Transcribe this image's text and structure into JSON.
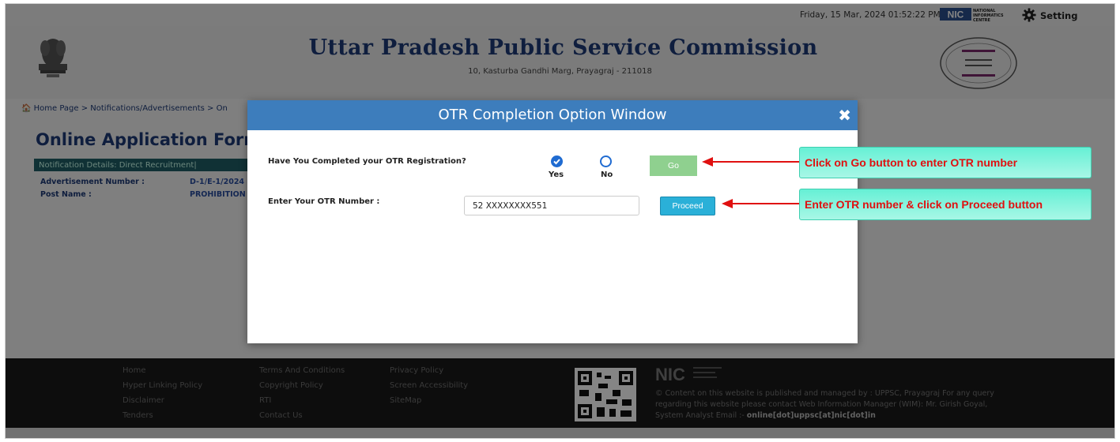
{
  "topbar": {
    "datetime": "Friday, 15 Mar, 2024 01:52:22 PM",
    "nic_small": "NATIONAL INFORMATICS CENTRE",
    "setting_label": "Setting"
  },
  "header": {
    "title": "Uttar Pradesh Public Service Commission",
    "address": "10, Kasturba Gandhi Marg, Prayagraj - 211018"
  },
  "breadcrumb": "🏠 Home Page > Notifications/Advertisements > On",
  "page": {
    "heading": "Online Application Form",
    "details_bar": "Notification Details: Direct Recruitment|",
    "rows": [
      {
        "label": "Advertisement Number :",
        "value": "D-1/E-1/2024"
      },
      {
        "label": "Post Name :",
        "value": "PROHIBITION"
      }
    ]
  },
  "modal": {
    "title": "OTR Completion Option Window",
    "close_symbol": "✖",
    "question_label": "Have You Completed your OTR Registration?",
    "radio_yes": "Yes",
    "radio_no": "No",
    "selected": "Yes",
    "go_label": "Go",
    "otr_label": "Enter Your OTR Number :",
    "otr_value": "52 XXXXXXXX551",
    "proceed_label": "Proceed"
  },
  "callouts": {
    "go": "Click on Go button to enter OTR number",
    "proceed": "Enter OTR number & click on Proceed button"
  },
  "footer": {
    "col1": [
      "Home",
      "Hyper Linking Policy",
      "Disclaimer",
      "Tenders"
    ],
    "col2": [
      "Terms And Conditions",
      "Copyright Policy",
      "RTI",
      "Contact Us"
    ],
    "col3": [
      "Privacy Policy",
      "Screen Accessibility",
      "SiteMap"
    ],
    "copy_text": "© Content on this website is published and managed by : UPPSC, Prayagraj For any query regarding this website please contact Web Information Manager (WIM): Mr. Girish Goyal, System Analyst Email :-",
    "email": "online[dot]uppsc[at]nic[dot]in"
  },
  "colors": {
    "modal_header": "#3d7dbc",
    "go_button": "#8fd08f",
    "proceed_button": "#2ab0d8",
    "annotation_arrow": "#e01010",
    "callout_bg": "#66f0d5"
  }
}
